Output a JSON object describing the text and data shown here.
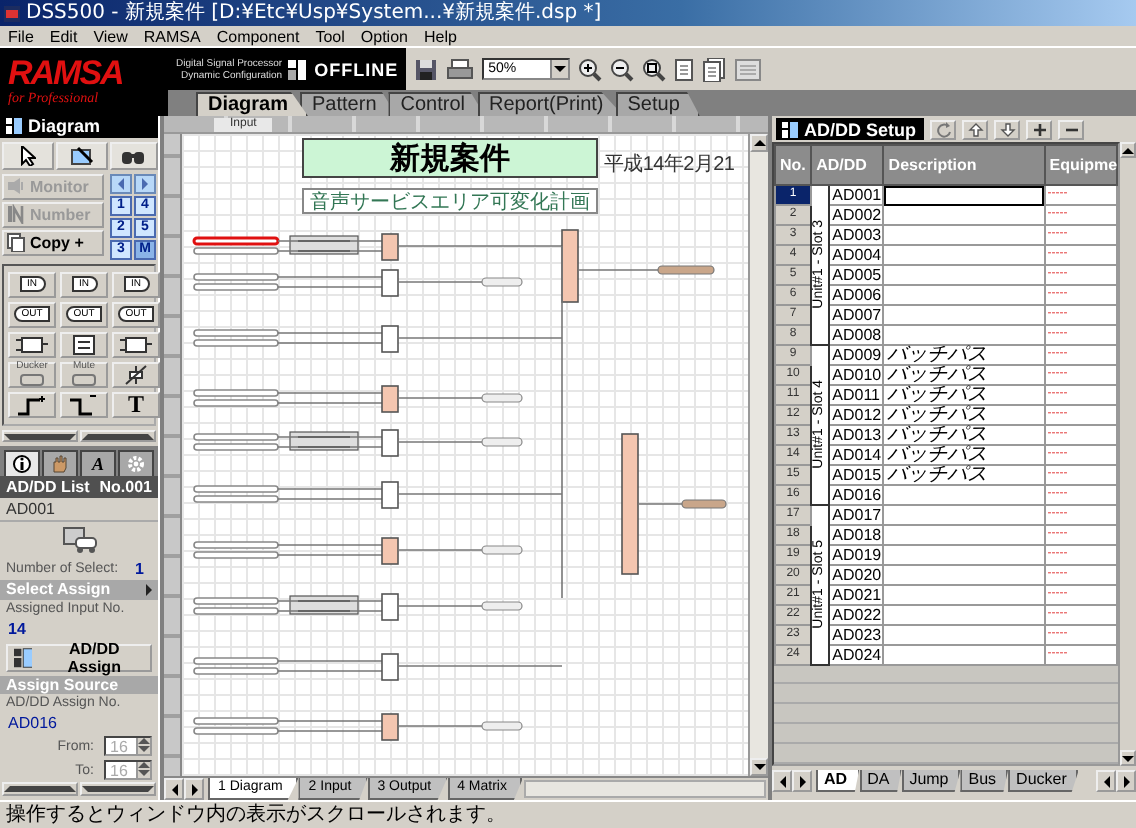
{
  "window": {
    "title": "DSS500 - 新規案件 [D:¥Etc¥Usp¥System...¥新規案件.dsp *]"
  },
  "menu": [
    "File",
    "Edit",
    "View",
    "RAMSA",
    "Component",
    "Tool",
    "Option",
    "Help"
  ],
  "toolbar": {
    "logo": "RAMSA",
    "tagline": "for Professional",
    "product_lines": [
      "Digital Signal Processor",
      "Dynamic Configuration"
    ],
    "mode": "OFFLINE",
    "zoom": "50%"
  },
  "tabs": [
    {
      "label": "Diagram",
      "selected": true
    },
    {
      "label": "Pattern",
      "selected": false
    },
    {
      "label": "Control",
      "selected": false
    },
    {
      "label": "Report(Print)",
      "selected": false
    },
    {
      "label": "Setup",
      "selected": false
    }
  ],
  "palette": {
    "title": "Diagram",
    "tools": [
      {
        "label": "Monitor",
        "kind": "monitor",
        "disabled": true
      },
      {
        "label": "Number",
        "kind": "number",
        "disabled": true
      },
      {
        "label": "Copy +",
        "kind": "copy",
        "disabled": false
      }
    ],
    "pages": [
      {
        "label": "1",
        "selected": false
      },
      {
        "label": "4",
        "selected": false
      },
      {
        "label": "2",
        "selected": false
      },
      {
        "label": "5",
        "selected": false
      },
      {
        "label": "3",
        "selected": false
      },
      {
        "label": "M",
        "selected": true
      }
    ],
    "components": [
      {
        "kind": "in",
        "label": "IN"
      },
      {
        "kind": "in",
        "label": "IN"
      },
      {
        "kind": "in",
        "label": "IN"
      },
      {
        "kind": "out",
        "label": "OUT"
      },
      {
        "kind": "out",
        "label": "OUT"
      },
      {
        "kind": "out",
        "label": "OUT"
      },
      {
        "kind": "mix"
      },
      {
        "kind": "matrix"
      },
      {
        "kind": "mix"
      },
      {
        "kind": "ducker",
        "label": "Ducker"
      },
      {
        "kind": "mute",
        "label": "Mute"
      },
      {
        "kind": "fader"
      },
      {
        "kind": "step-up"
      },
      {
        "kind": "step-down"
      },
      {
        "kind": "text",
        "label": "T"
      }
    ]
  },
  "inspector": {
    "tabs": [
      {
        "kind": "info",
        "selected": true
      },
      {
        "kind": "hand",
        "selected": false
      },
      {
        "kind": "font",
        "label": "A",
        "selected": false
      },
      {
        "kind": "gear",
        "selected": false
      }
    ],
    "list_title": "AD/DD List",
    "number": "No.001",
    "name": "AD001",
    "select_count_label": "Number of Select:",
    "select_count": "1",
    "select_assign": "Select Assign",
    "assigned_label": "Assigned Input No.",
    "assigned_value": "14",
    "assign_button": "AD/DD Assign",
    "assign_source": "Assign Source",
    "assign_no_label": "AD/DD Assign No.",
    "assign_no": "AD016",
    "from_label": "From:",
    "from": "16",
    "to_label": "To:",
    "to": "16"
  },
  "canvas": {
    "ruler_label": "Input",
    "title": "新規案件",
    "subtitle": "音声サービスエリア可変化計画",
    "date": "平成14年2月21",
    "sheet_tabs": [
      {
        "label": "1 Diagram",
        "selected": true
      },
      {
        "label": "2 Input",
        "selected": false
      },
      {
        "label": "3 Output",
        "selected": false
      },
      {
        "label": "4 Matrix",
        "selected": false
      }
    ]
  },
  "setup": {
    "title": "AD/DD Setup",
    "columns": [
      "No.",
      "AD/DD",
      "Description",
      "Equipme"
    ],
    "groups": [
      {
        "label": "Unit#1 - Slot 3",
        "rows": [
          {
            "no": "1",
            "id": "AD001",
            "equipment": "-----",
            "selected": true
          },
          {
            "no": "2",
            "id": "AD002",
            "equipment": "-----",
            "selected": false
          },
          {
            "no": "3",
            "id": "AD003",
            "equipment": "-----",
            "selected": false
          },
          {
            "no": "4",
            "id": "AD004",
            "equipment": "-----",
            "selected": false
          },
          {
            "no": "5",
            "id": "AD005",
            "equipment": "-----",
            "selected": false
          },
          {
            "no": "6",
            "id": "AD006",
            "equipment": "-----",
            "selected": false
          },
          {
            "no": "7",
            "id": "AD007",
            "equipment": "-----",
            "selected": false
          },
          {
            "no": "8",
            "id": "AD008",
            "equipment": "-----",
            "selected": false
          }
        ]
      },
      {
        "label": "Unit#1 - Slot 4",
        "rows": [
          {
            "no": "9",
            "id": "AD009",
            "description": "バッチパス",
            "equipment": "-----",
            "selected": false
          },
          {
            "no": "10",
            "id": "AD010",
            "description": "バッチパス",
            "equipment": "-----",
            "selected": false
          },
          {
            "no": "11",
            "id": "AD011",
            "description": "バッチパス",
            "equipment": "-----",
            "selected": false
          },
          {
            "no": "12",
            "id": "AD012",
            "description": "バッチパス",
            "equipment": "-----",
            "selected": false
          },
          {
            "no": "13",
            "id": "AD013",
            "description": "バッチパス",
            "equipment": "-----",
            "selected": false
          },
          {
            "no": "14",
            "id": "AD014",
            "description": "バッチパス",
            "equipment": "-----",
            "selected": false
          },
          {
            "no": "15",
            "id": "AD015",
            "description": "バッチパス",
            "equipment": "-----",
            "selected": false
          },
          {
            "no": "16",
            "id": "AD016",
            "equipment": "-----",
            "selected": false
          }
        ]
      },
      {
        "label": "Unit#1 - Slot 5",
        "rows": [
          {
            "no": "17",
            "id": "AD017",
            "equipment": "-----",
            "selected": false
          },
          {
            "no": "18",
            "id": "AD018",
            "equipment": "-----",
            "selected": false
          },
          {
            "no": "19",
            "id": "AD019",
            "equipment": "-----",
            "selected": false
          },
          {
            "no": "20",
            "id": "AD020",
            "equipment": "-----",
            "selected": false
          },
          {
            "no": "21",
            "id": "AD021",
            "equipment": "-----",
            "selected": false
          },
          {
            "no": "22",
            "id": "AD022",
            "equipment": "-----",
            "selected": false
          },
          {
            "no": "23",
            "id": "AD023",
            "equipment": "-----",
            "selected": false
          },
          {
            "no": "24",
            "id": "AD024",
            "equipment": "-----",
            "selected": false
          }
        ]
      }
    ],
    "sheet_tabs": [
      {
        "label": "AD",
        "selected": true
      },
      {
        "label": "DA",
        "selected": false
      },
      {
        "label": "Jump",
        "selected": false
      },
      {
        "label": "Bus",
        "selected": false
      },
      {
        "label": "Ducker",
        "selected": false
      }
    ]
  },
  "status_bar": "操作するとウィンドウ内の表示がスクロールされます。"
}
